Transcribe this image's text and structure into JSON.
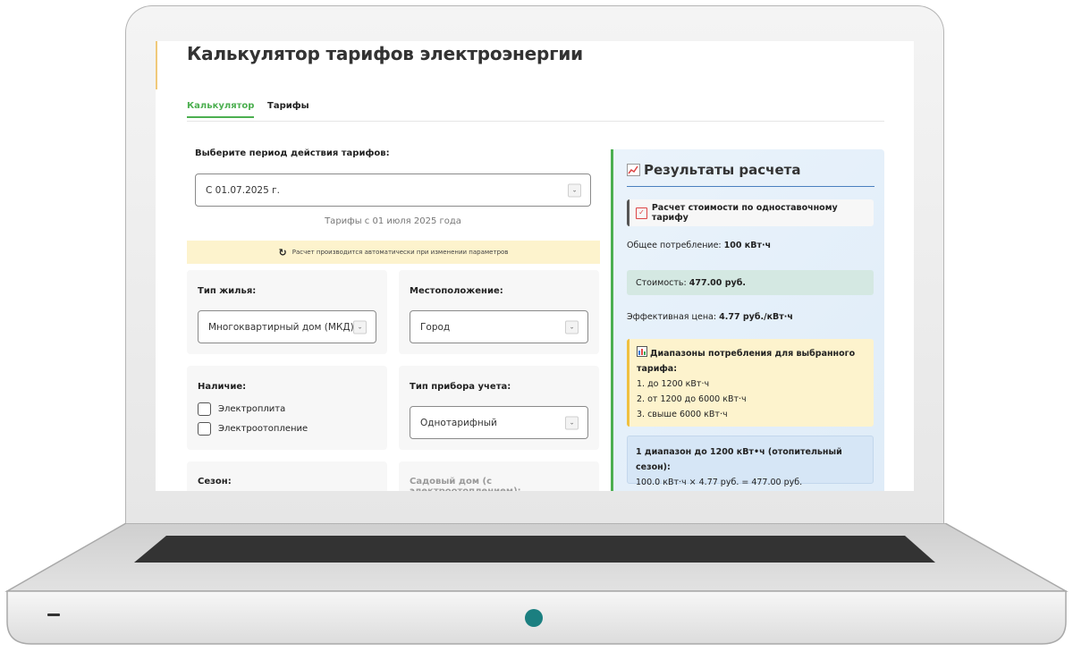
{
  "app": {
    "title": "Калькулятор тарифов электроэнергии",
    "tabs": [
      {
        "label": "Калькулятор",
        "active": true
      },
      {
        "label": "Тарифы",
        "active": false
      }
    ]
  },
  "period": {
    "label": "Выберите период действия тарифов:",
    "selected": "С 01.07.2025 г.",
    "note": "Тарифы с 01 июля 2025 года"
  },
  "auto_notice": "Расчет производится автоматически при изменении параметров",
  "housing": {
    "label": "Тип жилья:",
    "selected": "Многоквартирный дом (МКД)"
  },
  "location": {
    "label": "Местоположение:",
    "selected": "Город"
  },
  "availability": {
    "label": "Наличие:",
    "options": [
      {
        "label": "Электроплита",
        "checked": false
      },
      {
        "label": "Электроотопление",
        "checked": false
      }
    ]
  },
  "meter": {
    "label": "Тип прибора учета:",
    "selected": "Однотарифный"
  },
  "season": {
    "label": "Сезон:"
  },
  "garden": {
    "label": "Садовый дом (с электроотоплением):"
  },
  "results": {
    "title": "Результаты расчета",
    "method": "Расчет стоимости по одноставочному тарифу",
    "consumption_label": "Общее потребление:",
    "consumption_value": "100 кВт·ч",
    "cost_label": "Стоимость:",
    "cost_value": "477.00 руб.",
    "effective_label": "Эффективная цена:",
    "effective_value": "4.77 руб./кВт·ч",
    "ranges_title": "Диапазоны потребления для выбранного тарифа:",
    "ranges": [
      "1. до 1200 кВт·ч",
      "2. от 1200 до 6000 кВт·ч",
      "3. свыше 6000 кВт·ч"
    ],
    "calc_title": "1 диапазон до 1200 кВт•ч (отопительный сезон):",
    "calc_formula": "100.0 кВт·ч × 4.77 руб. = 477.00 руб."
  },
  "colors": {
    "accent_green": "#4caf50",
    "notice_yellow": "#fdf3cd",
    "results_bg": "#e4eff9",
    "power_led": "#1b7f80"
  },
  "icons": [
    "refresh-icon",
    "chevron-down-icon",
    "checkbox-icon",
    "chart-icon"
  ]
}
